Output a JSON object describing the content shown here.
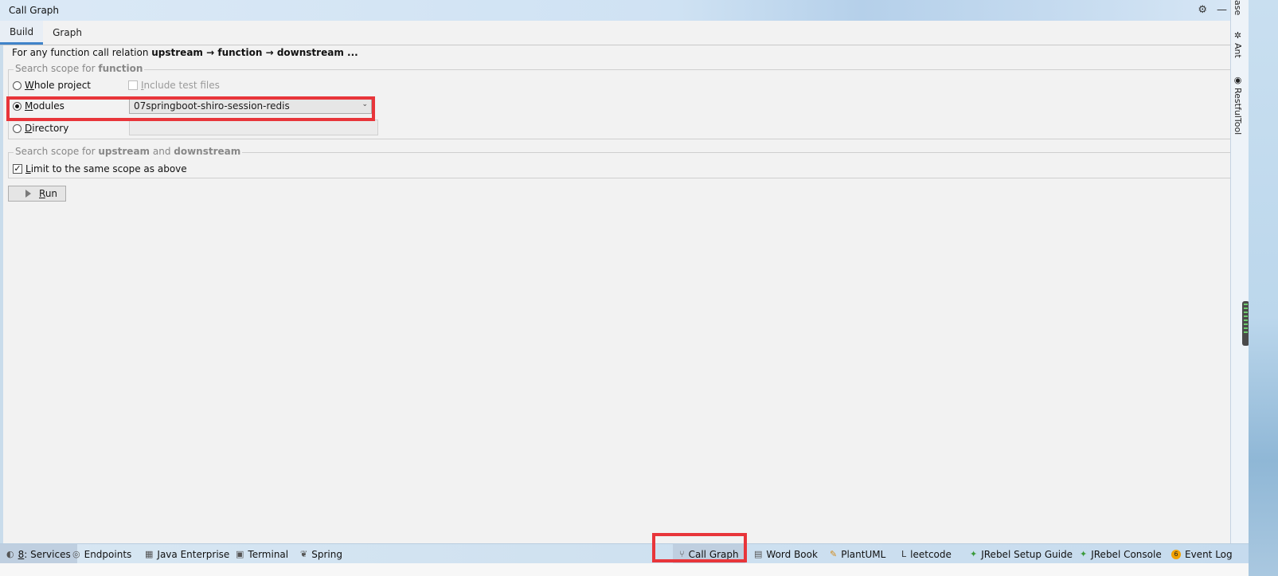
{
  "window": {
    "title": "Call Graph",
    "settings_icon": "gear-icon",
    "minimize_icon": "minimize-icon"
  },
  "tabs": [
    {
      "label": "Build",
      "active": true
    },
    {
      "label": "Graph",
      "active": false
    }
  ],
  "intro": {
    "prefix": "For any function call relation ",
    "upstream": "upstream",
    "arrow1": " → ",
    "function": "function",
    "arrow2": " → ",
    "downstream": "downstream",
    "suffix": " ..."
  },
  "scope_function": {
    "legend_prefix": "Search scope for ",
    "legend_bold": "function",
    "whole_project_first": "W",
    "whole_project_rest": "hole project",
    "include_tests_first": "I",
    "include_tests_rest": "nclude test files",
    "modules_first": "M",
    "modules_rest": "odules",
    "modules_value": "07springboot-shiro-session-redis",
    "directory_first": "D",
    "directory_rest": "irectory",
    "selected": "modules"
  },
  "scope_updown": {
    "legend_prefix": "Search scope for ",
    "legend_upstream": "upstream",
    "legend_and": " and ",
    "legend_downstream": "downstream",
    "limit_first": "L",
    "limit_rest": "imit to the same scope as above",
    "limit_checked": true
  },
  "run_button": {
    "first": "R",
    "rest": "un"
  },
  "right_tools": [
    {
      "label": "ase"
    },
    {
      "label": "Ant"
    },
    {
      "label": "RestfulTool"
    }
  ],
  "statusbar": {
    "items": [
      {
        "label_prefix": "8",
        "label": ": Services",
        "icon": "services-icon"
      },
      {
        "label": "Endpoints",
        "icon": "endpoints-icon"
      },
      {
        "label": "Java Enterprise",
        "icon": "java-enterprise-icon"
      },
      {
        "label": "Terminal",
        "icon": "terminal-icon"
      },
      {
        "label": "Spring",
        "icon": "spring-icon"
      },
      {
        "label": "Call Graph",
        "icon": "call-graph-icon"
      },
      {
        "label": "Word Book",
        "icon": "word-book-icon"
      },
      {
        "label": "PlantUML",
        "icon": "plantuml-icon"
      },
      {
        "label": "leetcode",
        "icon": "leetcode-icon"
      },
      {
        "label": "JRebel Setup Guide",
        "icon": "jrebel-icon"
      },
      {
        "label": "JRebel Console",
        "icon": "jrebel-icon"
      },
      {
        "label": "Event Log",
        "icon": "event-log-icon",
        "badge": "6"
      }
    ]
  },
  "highlight_color": "#e8353a"
}
